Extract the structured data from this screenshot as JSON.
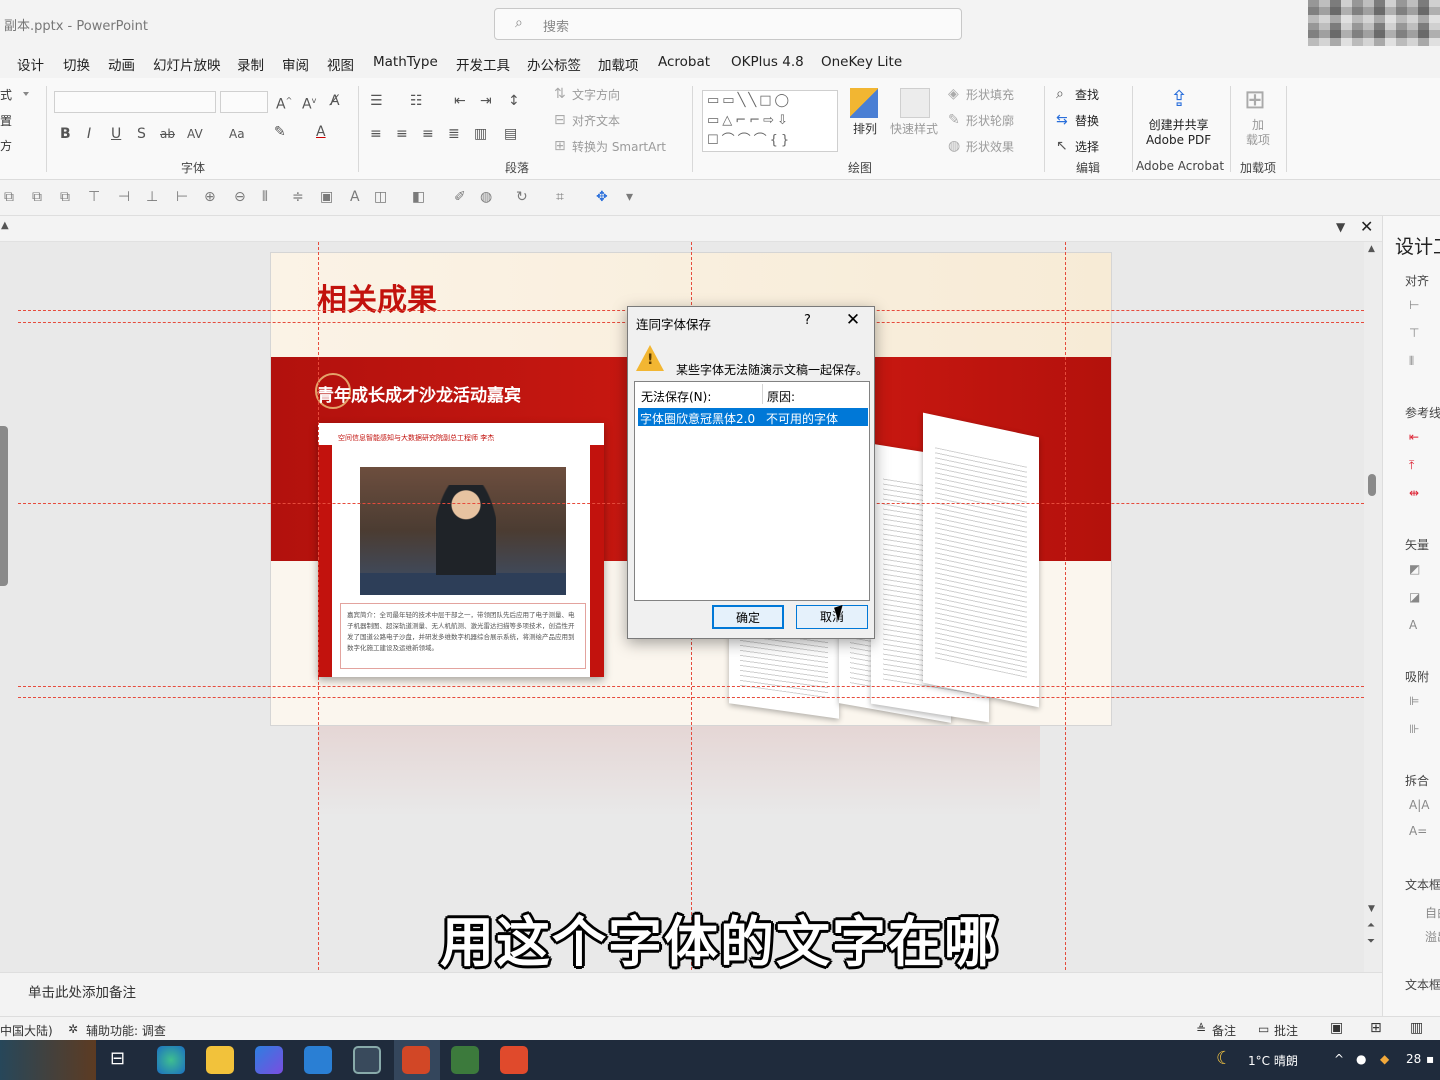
{
  "window": {
    "doc_title": "副本.pptx  -  PowerPoint",
    "search_placeholder": "搜索"
  },
  "menu": [
    "设计",
    "切换",
    "动画",
    "幻灯片放映",
    "录制",
    "审阅",
    "视图",
    "MathType",
    "开发工具",
    "办公标签",
    "加载项",
    "Acrobat",
    "OKPlus 4.8",
    "OneKey Lite"
  ],
  "ribbon": {
    "left_items": [
      "式",
      "置",
      "方"
    ],
    "font_group": "字体",
    "paragraph_group": "段落",
    "paragraph_items": [
      "文字方向",
      "对齐文本",
      "转换为 SmartArt"
    ],
    "drawing_group": "绘图",
    "drawing_items": {
      "arrange": "排列",
      "quick_styles": "快速样式",
      "fill": "形状填充",
      "outline": "形状轮廓",
      "effects": "形状效果"
    },
    "editing_group": "编辑",
    "editing_items": [
      "查找",
      "替换",
      "选择"
    ],
    "acrobat_button": "创建并共享\nAdobe PDF",
    "acrobat_group": "Adobe Acrobat",
    "addins_button": "加\n载项",
    "addins_group": "加载项"
  },
  "slide": {
    "title": "相关成果",
    "section_title": "青年成长成才沙龙活动嘉宾",
    "card_caption": "空间信息智能感知与大数据研究院副总工程师 李杰",
    "card_desc": "嘉宾简介：全司最年轻的技术中层干部之一，带领团队先后应用了电子测量、电子机器制图、超深轨道测量、无人机航测、激光雷达扫描等多项技术，创造性开发了国道公路电子沙盘，并研发多维数字机器综合展示系统，将测绘产品应用到数字化施工建设及运维新领域。"
  },
  "notes_placeholder": "单击此处添加备注",
  "subtitle": "用这个字体的文字在哪",
  "right_pane": {
    "title": "设计工",
    "labels": [
      "对齐",
      "参考线",
      "矢量",
      "吸附",
      "拆合",
      "文本框",
      "文本框"
    ],
    "sub": [
      "自由",
      "溢出"
    ]
  },
  "status": {
    "language": "中国大陆)",
    "accessibility": "辅助功能: 调查",
    "notes": "备注",
    "comments": "批注"
  },
  "taskbar": {
    "weather": "1°C  晴朗",
    "time": "28"
  },
  "dialog": {
    "title": "连同字体保存",
    "help": "?",
    "message": "某些字体无法随演示文稿一起保存。",
    "col1": "无法保存(N):",
    "col2": "原因:",
    "row_font": "字体圈欣意冠黑体2.0",
    "row_reason": "不可用的字体",
    "ok": "确定",
    "cancel": "取消"
  }
}
